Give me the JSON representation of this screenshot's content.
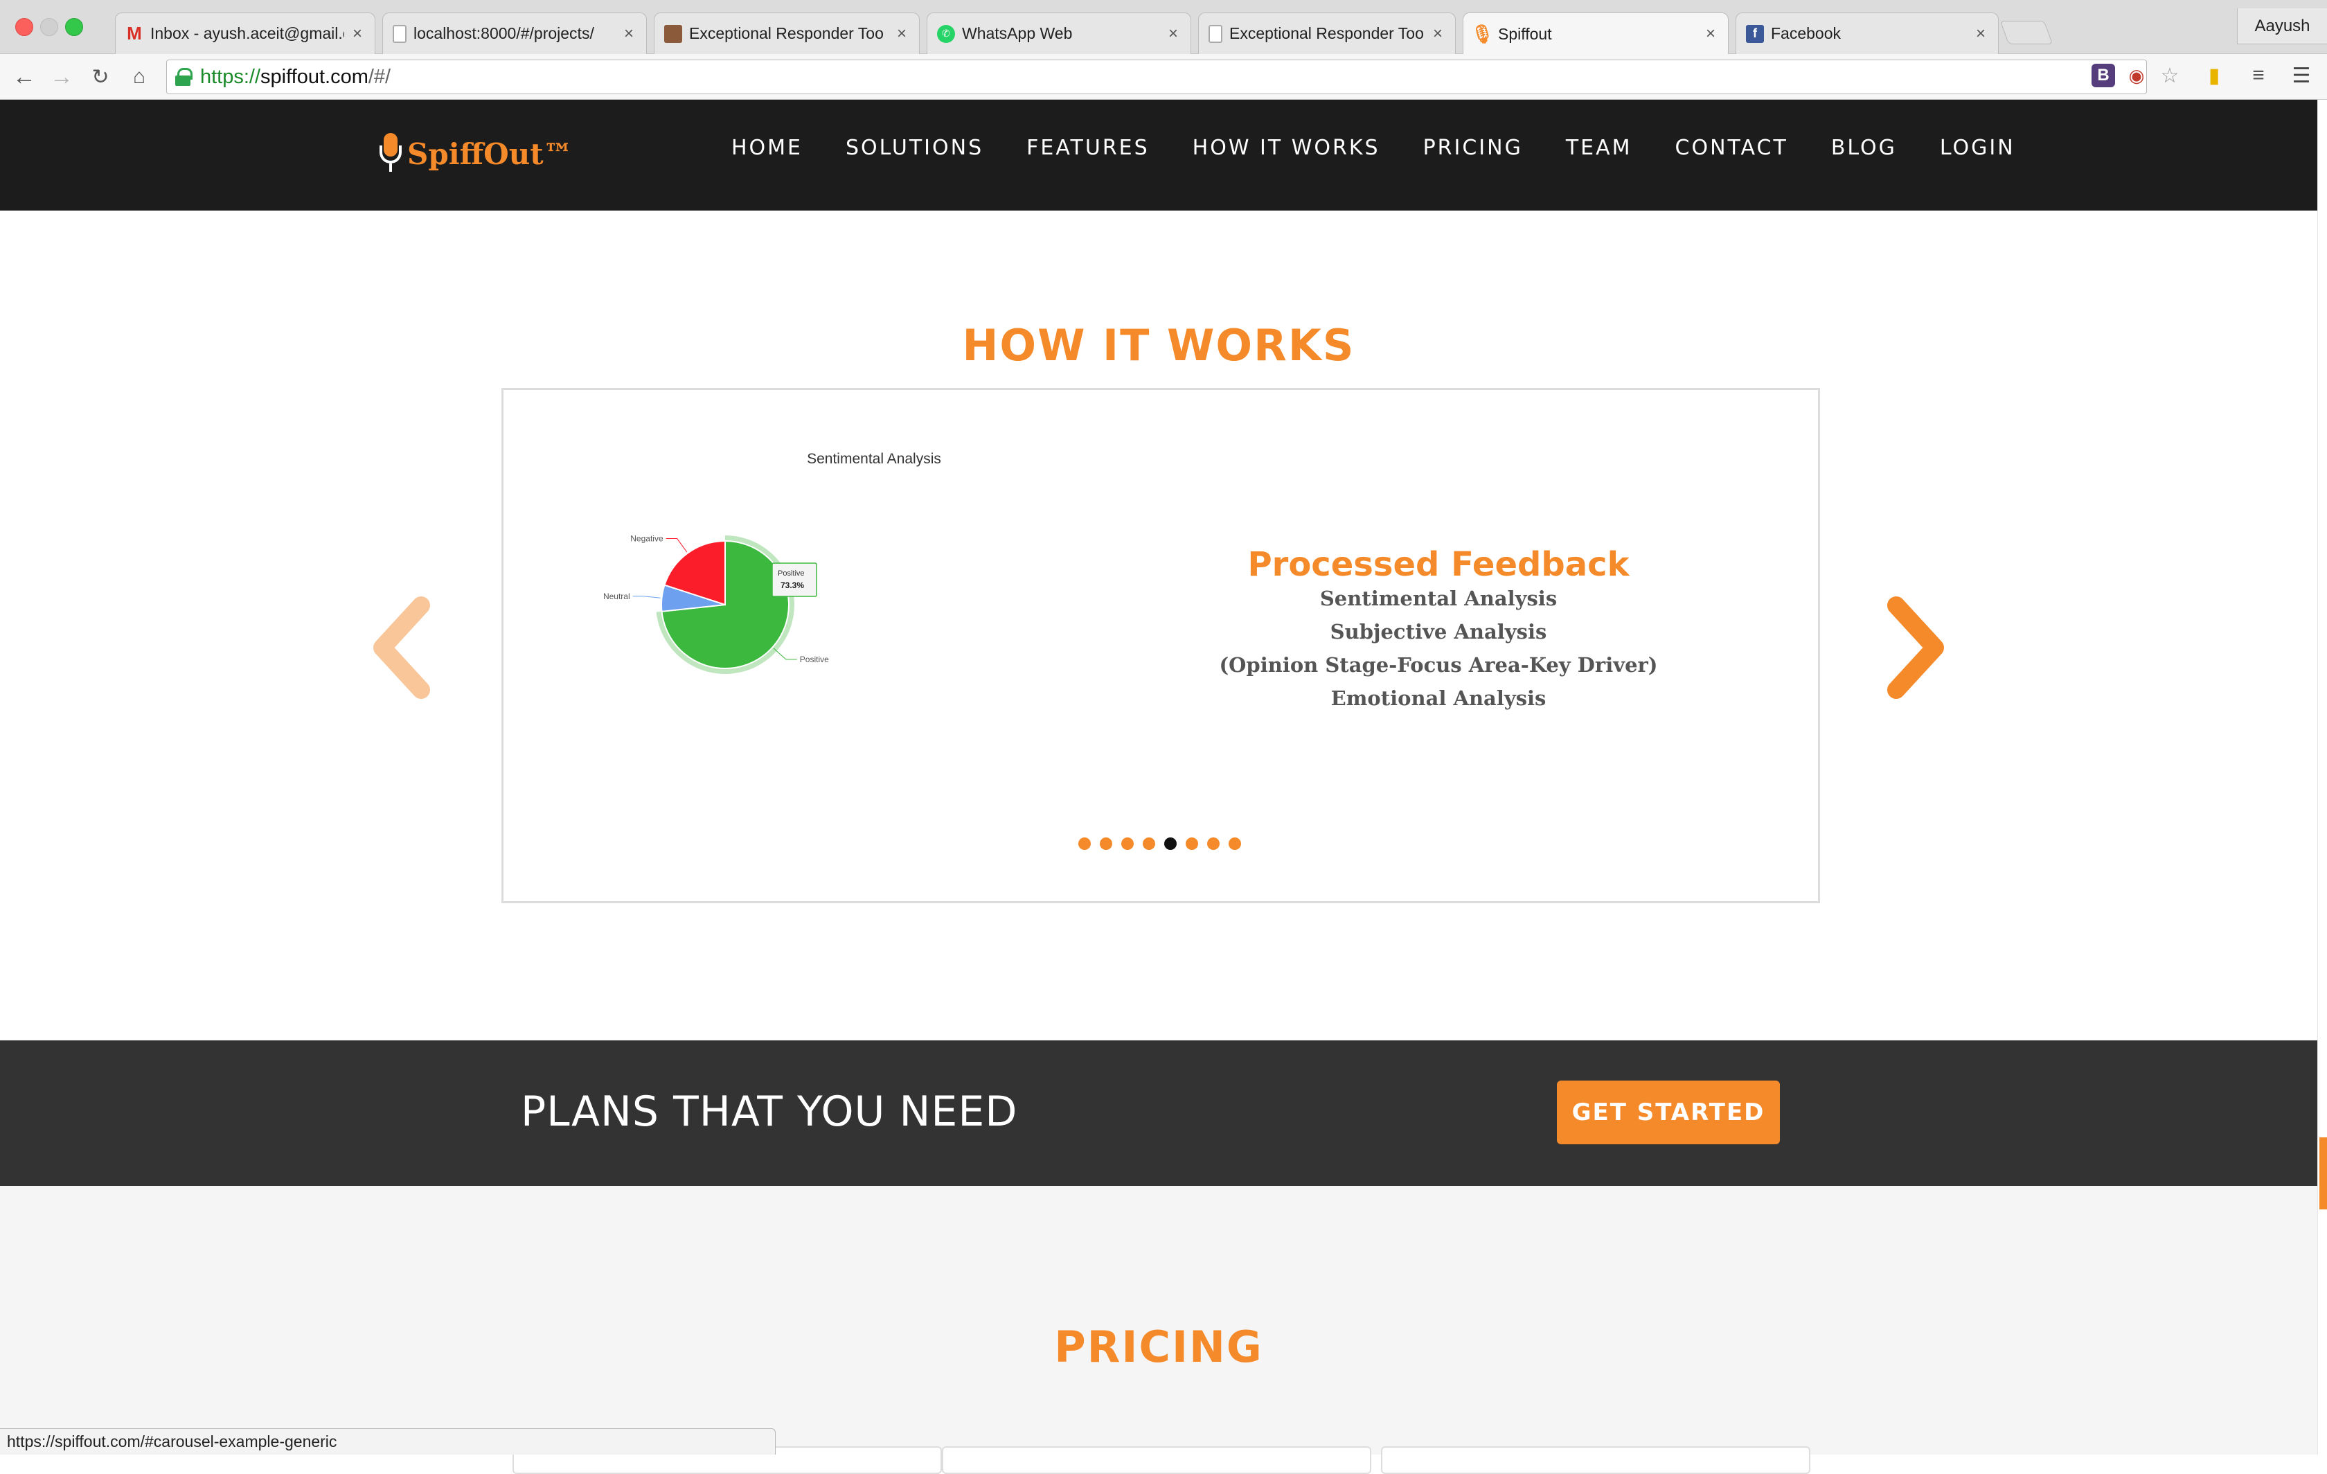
{
  "browser": {
    "tabs": [
      {
        "title": "Inbox - ayush.aceit@gmail.c",
        "icon": "gmail-icon"
      },
      {
        "title": "localhost:8000/#/projects/",
        "icon": "document-icon"
      },
      {
        "title": "Exceptional Responder Too",
        "icon": "image-icon"
      },
      {
        "title": "WhatsApp Web",
        "icon": "whatsapp-icon"
      },
      {
        "title": "Exceptional Responder Too",
        "icon": "document-icon"
      },
      {
        "title": "Spiffout",
        "icon": "microphone-icon"
      },
      {
        "title": "Facebook",
        "icon": "facebook-icon"
      }
    ],
    "active_tab_index": 5,
    "profile_name": "Aayush",
    "url": {
      "scheme": "https://",
      "host": "spiffout.com",
      "path": "/#/"
    },
    "status_url": "https://spiffout.com/#carousel-example-generic"
  },
  "site": {
    "logo_text": "SpiffOut™",
    "nav": [
      "HOME",
      "SOLUTIONS",
      "FEATURES",
      "HOW IT WORKS",
      "PRICING",
      "TEAM",
      "CONTACT",
      "BLOG",
      "LOGIN"
    ],
    "how_it_works_title": "HOW IT WORKS",
    "slide": {
      "heading": "Processed Feedback",
      "lines": [
        "Sentimental Analysis",
        "Subjective Analysis",
        "(Opinion Stage-Focus Area-Key Driver)",
        "Emotional Analysis"
      ],
      "dot_count": 8,
      "active_dot": 4
    },
    "plans_text": "PLANS THAT YOU NEED",
    "cta_label": "GET STARTED",
    "pricing_title": "PRICING"
  },
  "chart_data": {
    "type": "pie",
    "title": "Sentimental Analysis",
    "categories": [
      "Positive",
      "Neutral",
      "Negative"
    ],
    "values": [
      73.3,
      6.7,
      20.0
    ],
    "colors": [
      "#3cb83f",
      "#6ea0f0",
      "#fc1d2b"
    ],
    "tooltip": {
      "label": "Positive",
      "value": "73.3%"
    }
  },
  "colors": {
    "accent": "#f58a2b",
    "nav_bg": "#1c1c1c",
    "band_bg": "#333333"
  }
}
